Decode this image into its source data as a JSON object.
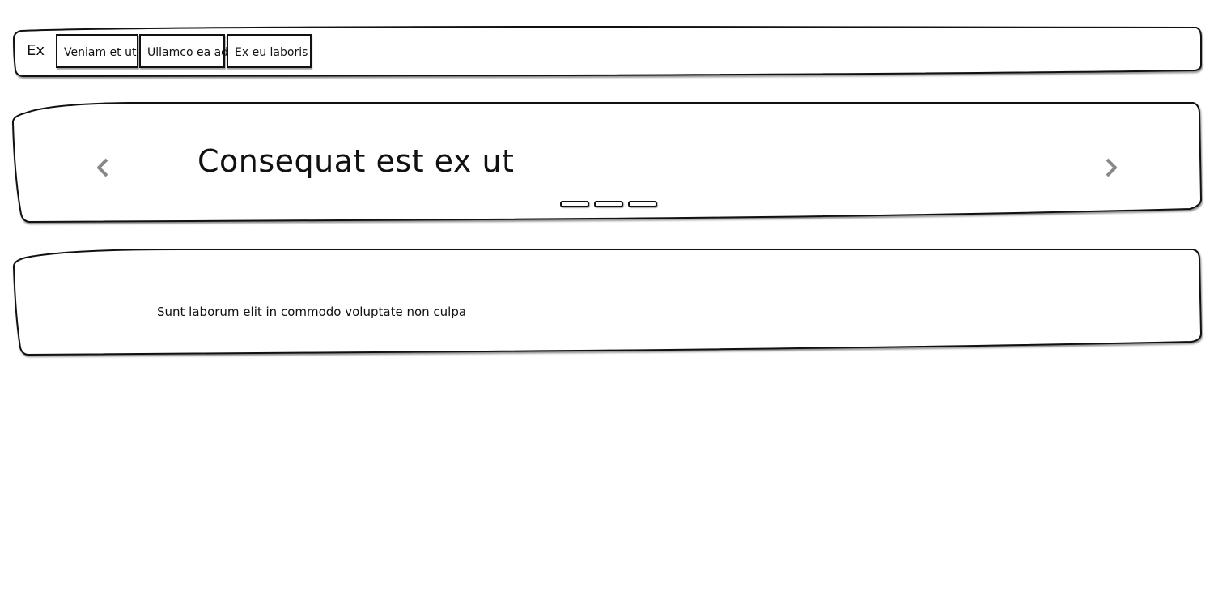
{
  "navbar": {
    "brand": "Ex",
    "links": [
      {
        "label": "Veniam et ut"
      },
      {
        "label": "Ullamco ea ad"
      },
      {
        "label": "Ex eu laboris"
      }
    ]
  },
  "carousel": {
    "slide_title": "Consequat est ex ut",
    "prev_icon": "chevron-left-icon",
    "next_icon": "chevron-right-icon",
    "indicator_count": 3,
    "arrow_color": "#888888"
  },
  "content": {
    "text": "Sunt laborum elit in commodo voluptate non culpa"
  }
}
